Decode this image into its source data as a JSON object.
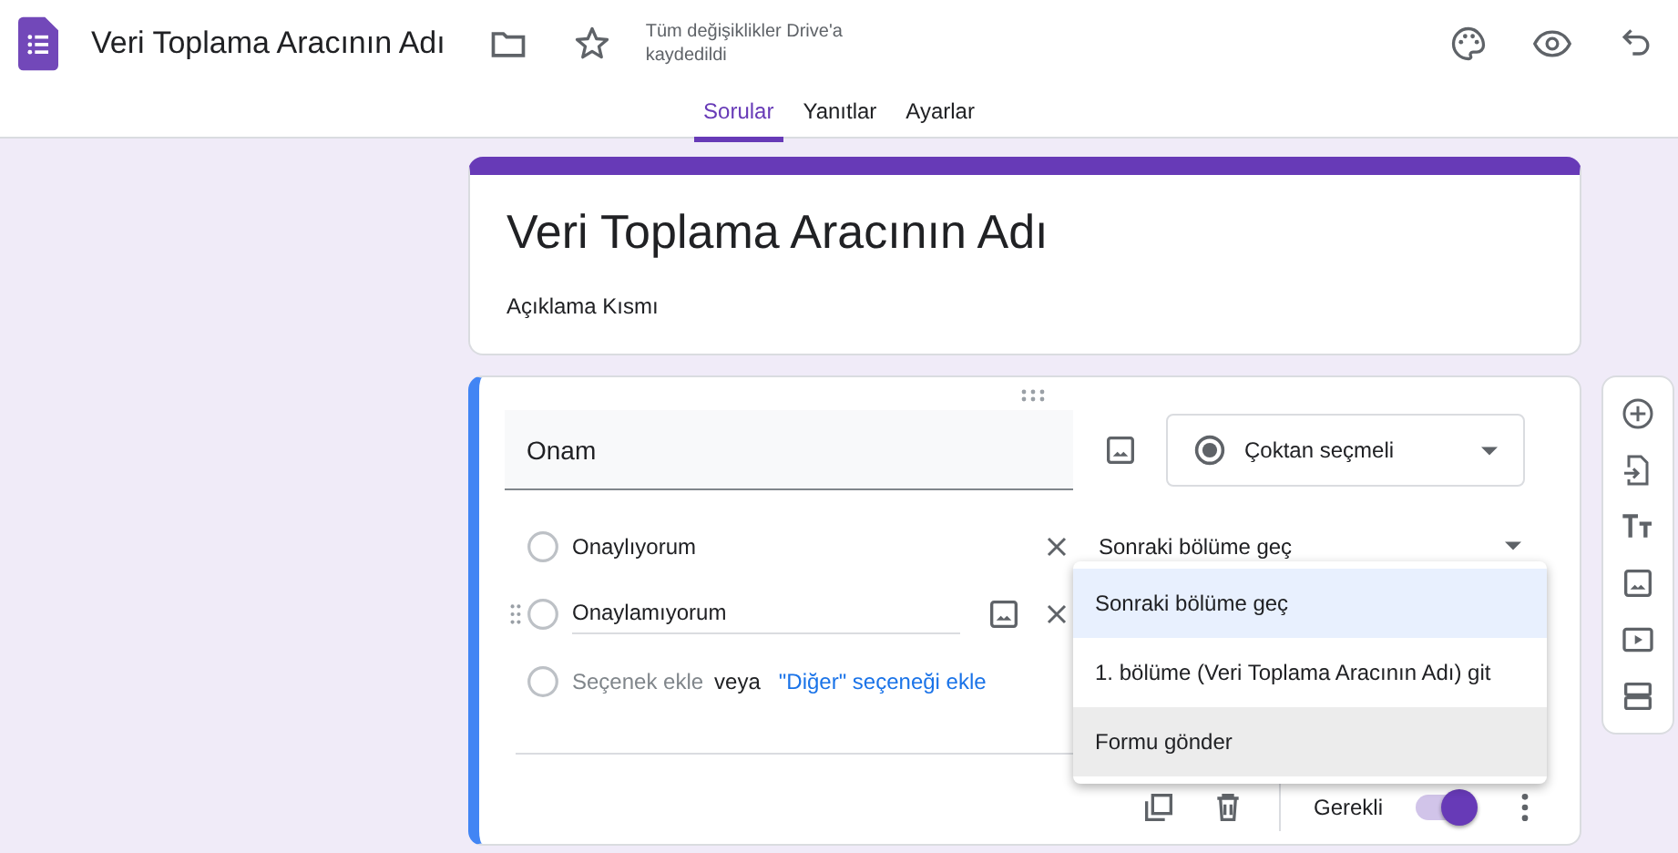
{
  "header": {
    "title": "Veri Toplama Aracının Adı",
    "save_status": "Tüm değişiklikler Drive'a kaydedildi",
    "tabs": [
      {
        "label": "Sorular",
        "selected": true
      },
      {
        "label": "Yanıtlar",
        "selected": false
      },
      {
        "label": "Ayarlar",
        "selected": false
      }
    ]
  },
  "form_header": {
    "title": "Veri Toplama Aracının Adı",
    "description": "Açıklama Kısmı"
  },
  "question": {
    "title": "Onam",
    "type": "Çoktan seçmeli",
    "options": [
      {
        "label": "Onaylıyorum",
        "branch": "Sonraki bölüme geç"
      },
      {
        "label": "Onaylamıyorum"
      }
    ],
    "add_option": "Seçenek ekle",
    "or": "veya",
    "add_other": "\"Diğer\" seçeneği ekle",
    "branch_menu": [
      {
        "label": "Sonraki bölüme geç",
        "selected": true,
        "hovered": false
      },
      {
        "label": "1. bölüme (Veri Toplama Aracının Adı) git",
        "selected": false,
        "hovered": false
      },
      {
        "label": "Formu gönder",
        "selected": false,
        "hovered": true
      }
    ],
    "required_label": "Gerekli",
    "required": true
  }
}
